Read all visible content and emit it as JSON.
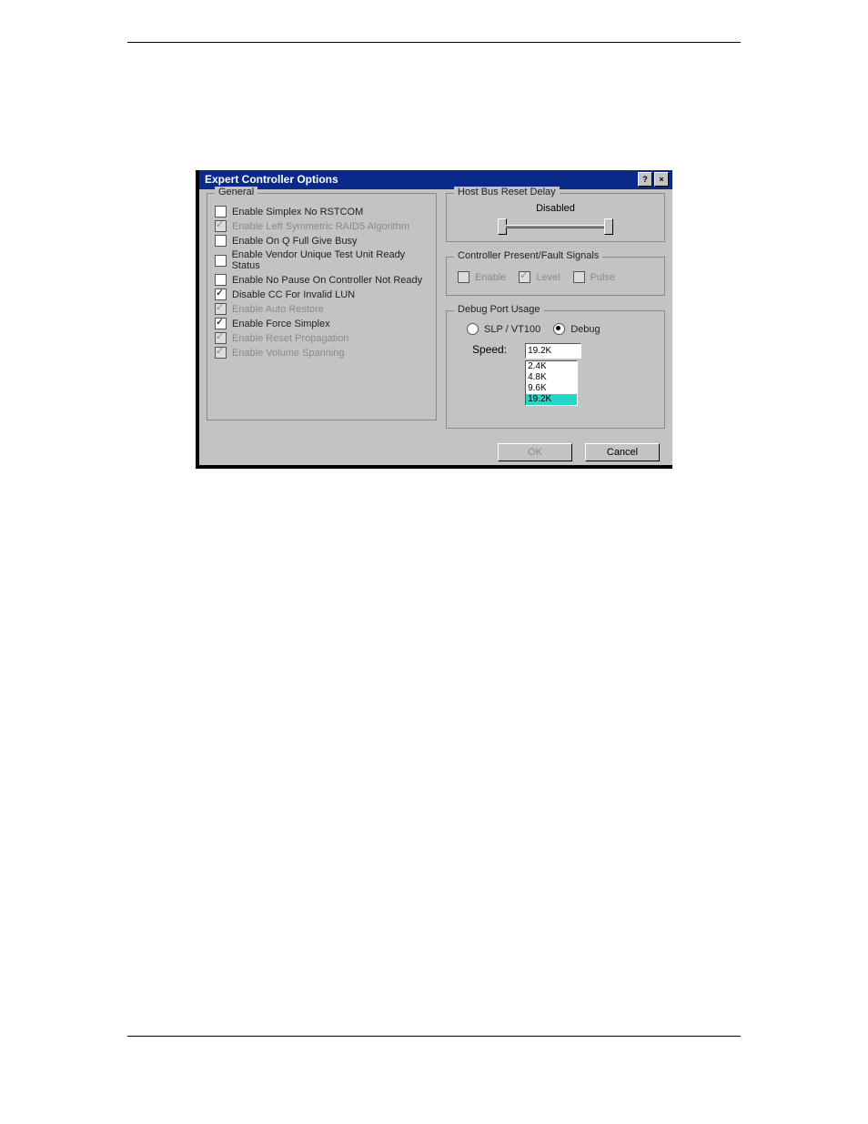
{
  "window": {
    "title": "Expert Controller Options"
  },
  "general": {
    "legend": "General",
    "options": [
      {
        "label": "Enable Simplex No RSTCOM",
        "checked": false,
        "enabled": true
      },
      {
        "label": "Enable Left Symmetric RAID5 Algorithm",
        "checked": true,
        "enabled": false
      },
      {
        "label": "Enable On Q Full Give Busy",
        "checked": false,
        "enabled": true
      },
      {
        "label": "Enable Vendor Unique Test Unit Ready Status",
        "checked": false,
        "enabled": true
      },
      {
        "label": "Enable No Pause On Controller Not Ready",
        "checked": false,
        "enabled": true
      },
      {
        "label": "Disable CC For Invalid LUN",
        "checked": true,
        "enabled": true
      },
      {
        "label": "Enable Auto Restore",
        "checked": true,
        "enabled": false
      },
      {
        "label": "Enable Force Simplex",
        "checked": true,
        "enabled": true
      },
      {
        "label": "Enable Reset Propagation",
        "checked": true,
        "enabled": false
      },
      {
        "label": "Enable Volume Spanning",
        "checked": true,
        "enabled": false
      }
    ]
  },
  "hostBusResetDelay": {
    "legend": "Host Bus Reset Delay",
    "status": "Disabled"
  },
  "controllerSignals": {
    "legend": "Controller Present/Fault Signals",
    "options": [
      {
        "label": "Enable",
        "checked": false,
        "enabled": false
      },
      {
        "label": "Level",
        "checked": true,
        "enabled": false
      },
      {
        "label": "Pulse",
        "checked": false,
        "enabled": false
      }
    ]
  },
  "debugPort": {
    "legend": "Debug Port Usage",
    "mode": {
      "options": [
        {
          "label": "SLP / VT100",
          "checked": false
        },
        {
          "label": "Debug",
          "checked": true
        }
      ]
    },
    "speedLabel": "Speed:",
    "speedSelected": "19.2K",
    "speedOptions": [
      "2.4K",
      "4.8K",
      "9.6K",
      "19.2K"
    ]
  },
  "buttons": {
    "ok": "OK",
    "cancel": "Cancel"
  }
}
